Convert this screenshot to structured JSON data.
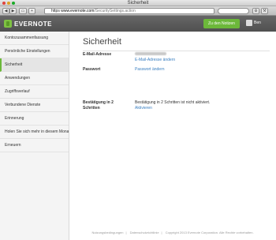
{
  "window": {
    "title": "Sicherheit"
  },
  "browser": {
    "url_host": "https",
    "url_text": "www.evernote.com",
    "url_path": "/SecuritySettings.action"
  },
  "header": {
    "logo_text": "EVERNOTE",
    "notes_button": "Zu den Notizen",
    "user_name": "Ben"
  },
  "sidebar": {
    "items": [
      {
        "label": "Kontozusammenfassung"
      },
      {
        "label": "Persönliche Einstellungen"
      },
      {
        "label": "Sicherheit"
      },
      {
        "label": "Anwendungen"
      },
      {
        "label": "Zugriffsverlauf"
      },
      {
        "label": "Verbundene Dienste"
      },
      {
        "label": "Erinnerung"
      },
      {
        "label": "Holen Sie sich mehr in diesem Monat"
      },
      {
        "label": "Erneuern"
      }
    ]
  },
  "main": {
    "title": "Sicherheit",
    "email_label": "E-Mail-Adresse",
    "email_link": "E-Mail-Adresse ändern",
    "password_label": "Passwort",
    "password_link": "Passwort ändern",
    "twofa_label": "Bestätigung in 2 Schritten",
    "twofa_status": "Bestätigung in 2 Schritten ist nicht aktiviert.",
    "twofa_link": "Aktivieren"
  },
  "footer": {
    "links": [
      "Nutzungsbedingungen",
      "Datenschutzrichtlinie",
      "Copyright 2013 Evernote Corporation. Alle Rechte vorbehalten."
    ]
  },
  "colors": {
    "accent": "#6cb83a",
    "link": "#3a7fc1",
    "header": "#5c5c5c"
  }
}
